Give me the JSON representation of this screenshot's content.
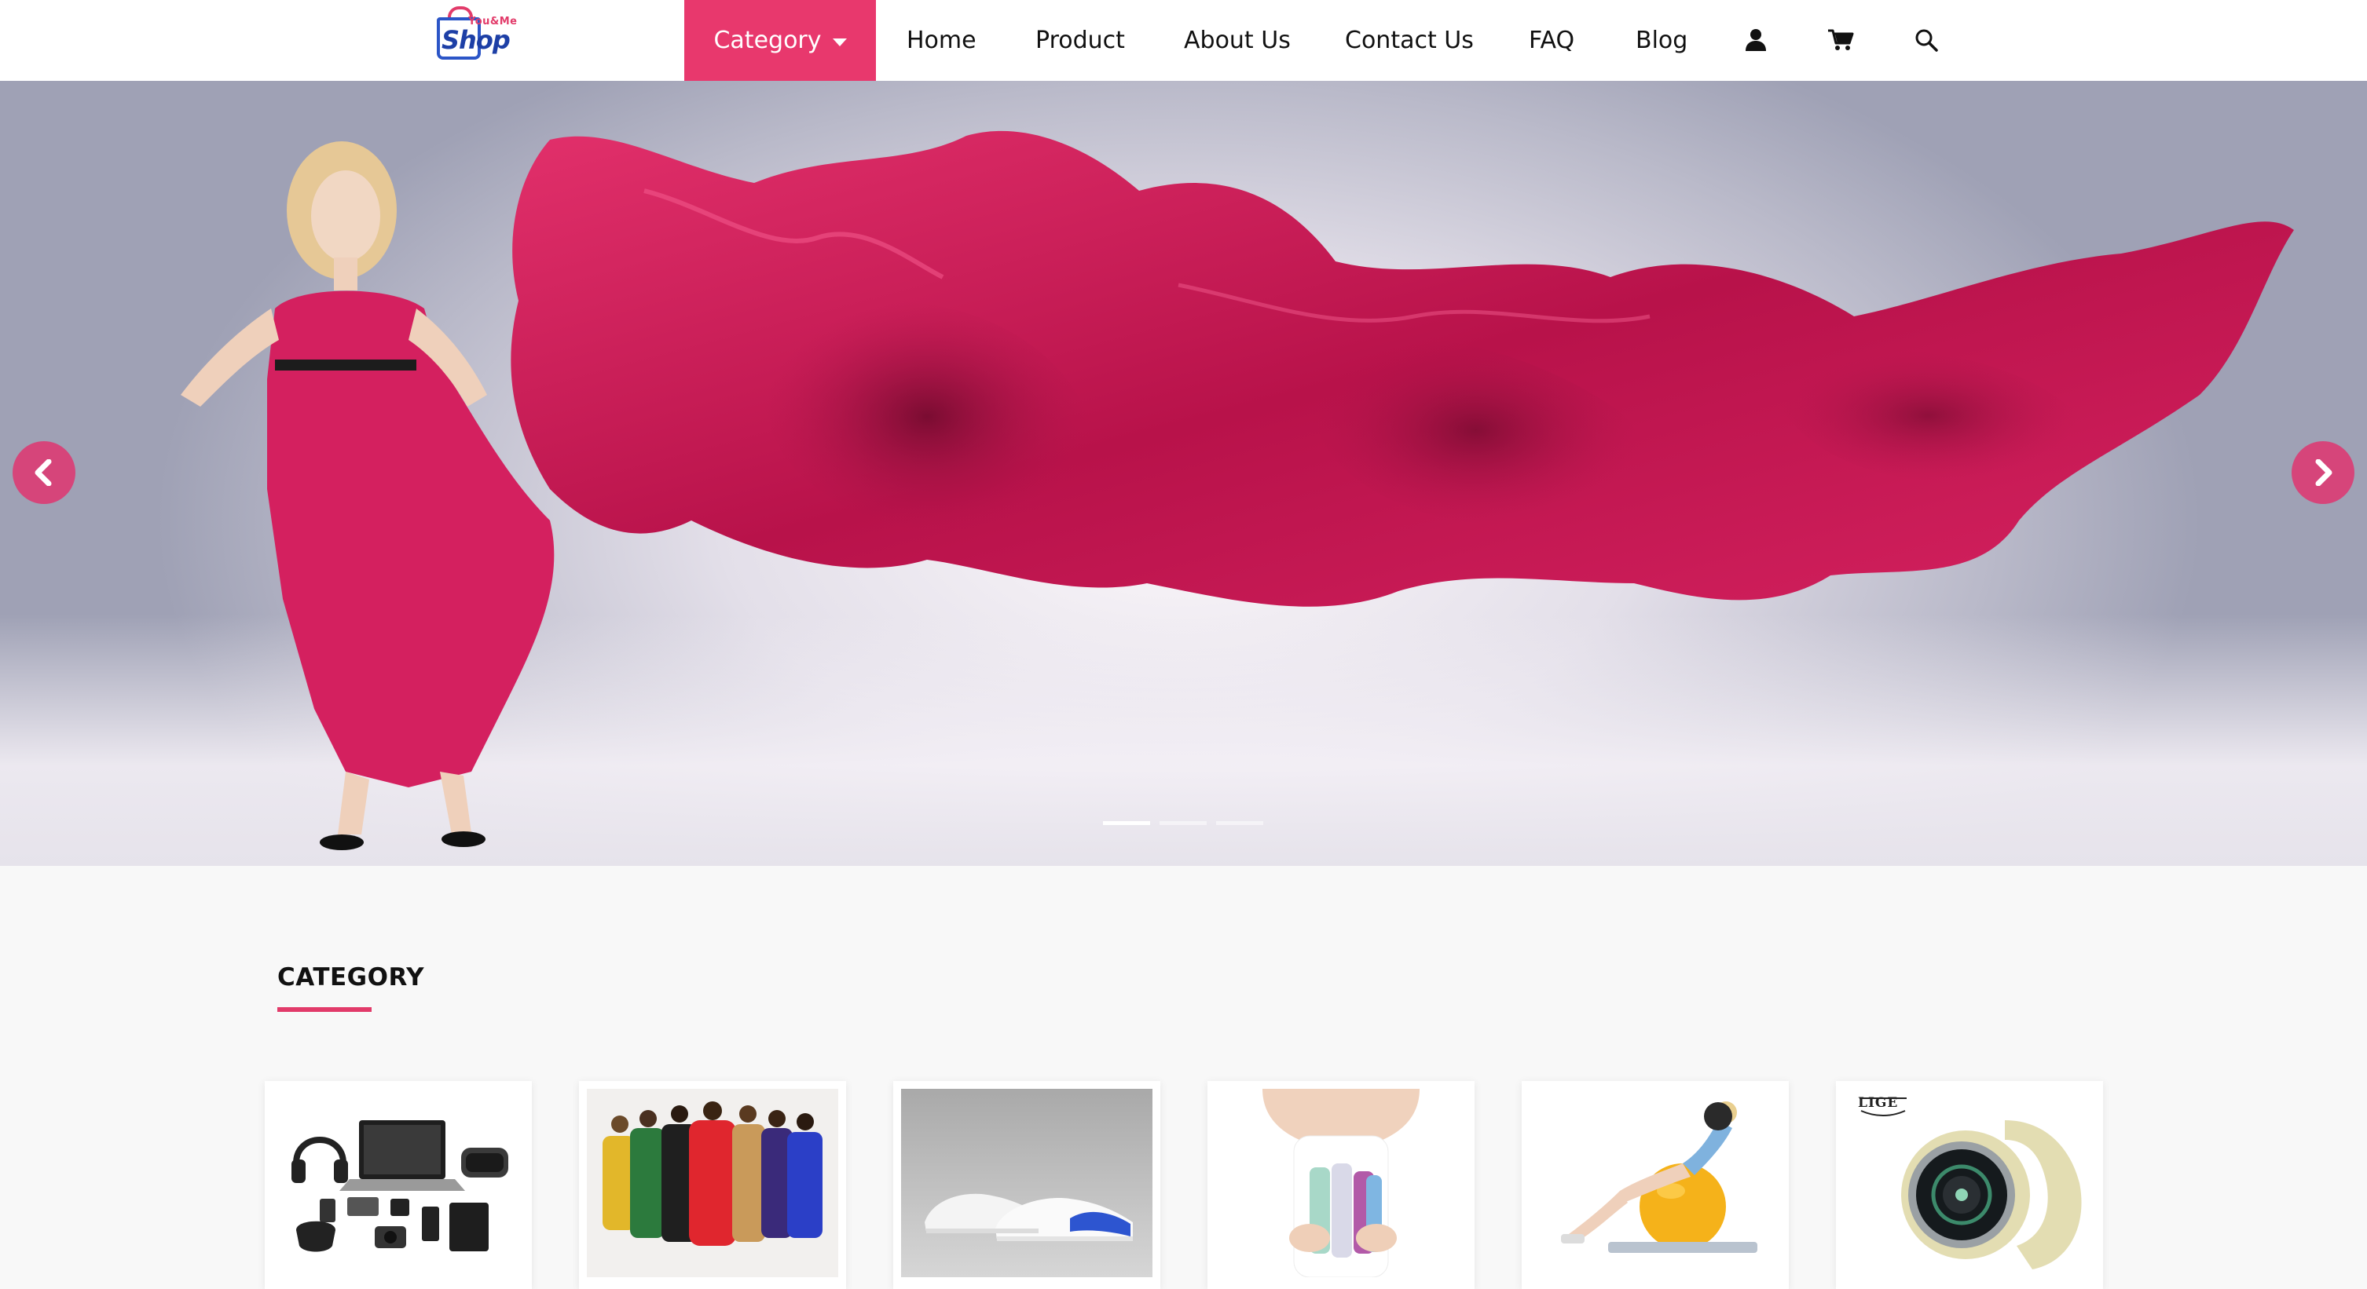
{
  "brand": {
    "logo_top": "You&Me",
    "logo_main": "Shop",
    "accent_color": "#e8386d",
    "brand_blue": "#1d3fa6"
  },
  "nav": {
    "category_label": "Category",
    "links": [
      "Home",
      "Product",
      "About Us",
      "Contact Us",
      "FAQ",
      "Blog"
    ],
    "icons": [
      "user-icon",
      "cart-icon",
      "search-icon"
    ]
  },
  "hero": {
    "slide_count": 3,
    "active_slide": 1,
    "image": "woman-in-flowing-red-dress",
    "prev_icon": "chevron-left-icon",
    "next_icon": "chevron-right-icon"
  },
  "category": {
    "heading": "CATEGORY",
    "cards": [
      {
        "image": "electronics-gadgets"
      },
      {
        "image": "fashion-runway-models"
      },
      {
        "image": "white-sneakers"
      },
      {
        "image": "beauty-cosmetics"
      },
      {
        "image": "fitness-ball-exercise"
      },
      {
        "image": "smartwatch",
        "brand_mark": "LIGE"
      }
    ]
  }
}
